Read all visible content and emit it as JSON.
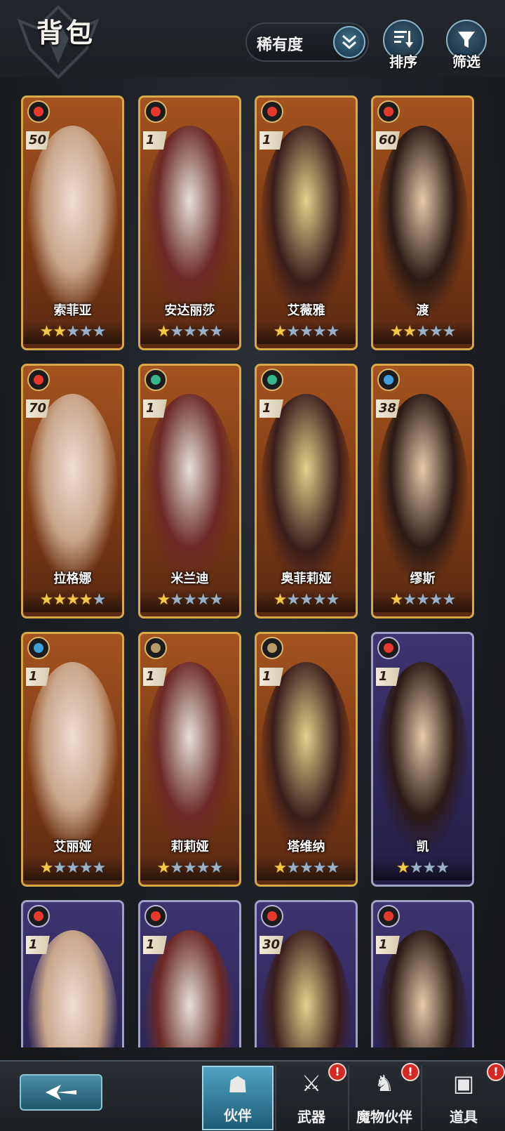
{
  "header": {
    "title": "背包",
    "sort_dropdown": {
      "selected": "稀有度"
    },
    "sort_button_label": "排序",
    "filter_button_label": "筛选"
  },
  "cards": [
    {
      "name": "索菲亚",
      "level": "50",
      "element": "fire",
      "rarity": "gold",
      "stars": 2,
      "max_stars": 5
    },
    {
      "name": "安达丽莎",
      "level": "1",
      "element": "fire",
      "rarity": "gold",
      "stars": 1,
      "max_stars": 5
    },
    {
      "name": "艾薇雅",
      "level": "1",
      "element": "fire",
      "rarity": "gold",
      "stars": 1,
      "max_stars": 5
    },
    {
      "name": "渡",
      "level": "60",
      "element": "fire",
      "rarity": "gold",
      "stars": 2,
      "max_stars": 5
    },
    {
      "name": "拉格娜",
      "level": "70",
      "element": "fire",
      "rarity": "gold",
      "stars": 4,
      "max_stars": 5
    },
    {
      "name": "米兰迪",
      "level": "1",
      "element": "wind",
      "rarity": "gold",
      "stars": 1,
      "max_stars": 5
    },
    {
      "name": "奥菲莉娅",
      "level": "1",
      "element": "wind",
      "rarity": "gold",
      "stars": 1,
      "max_stars": 5
    },
    {
      "name": "缪斯",
      "level": "38",
      "element": "water",
      "rarity": "gold",
      "stars": 1,
      "max_stars": 5
    },
    {
      "name": "艾丽娅",
      "level": "1",
      "element": "water",
      "rarity": "gold",
      "stars": 1,
      "max_stars": 5
    },
    {
      "name": "莉莉娅",
      "level": "1",
      "element": "earth",
      "rarity": "gold",
      "stars": 1,
      "max_stars": 5
    },
    {
      "name": "塔维纳",
      "level": "1",
      "element": "earth",
      "rarity": "gold",
      "stars": 1,
      "max_stars": 5
    },
    {
      "name": "凯",
      "level": "1",
      "element": "fire",
      "rarity": "purple",
      "stars": 1,
      "max_stars": 4
    },
    {
      "name": "",
      "level": "1",
      "element": "fire",
      "rarity": "purple",
      "stars": 0,
      "max_stars": 0
    },
    {
      "name": "",
      "level": "1",
      "element": "fire",
      "rarity": "purple",
      "stars": 0,
      "max_stars": 0
    },
    {
      "name": "",
      "level": "30",
      "element": "fire",
      "rarity": "purple",
      "stars": 0,
      "max_stars": 0
    },
    {
      "name": "",
      "level": "1",
      "element": "fire",
      "rarity": "purple",
      "stars": 0,
      "max_stars": 0
    }
  ],
  "colors": {
    "fire": "#e5392e",
    "wind": "#35b58a",
    "water": "#3f9fd6",
    "earth": "#b59a6a",
    "star_on": "#f3c94a",
    "star_off": "#9ab0c6"
  },
  "bottom_nav": {
    "back_icon": "arrow-left-icon",
    "tabs": [
      {
        "label": "伙伴",
        "icon": "companion-icon",
        "active": true,
        "badge": ""
      },
      {
        "label": "武器",
        "icon": "crossed-swords-icon",
        "active": false,
        "badge": "!"
      },
      {
        "label": "魔物伙伴",
        "icon": "dragon-icon",
        "active": false,
        "badge": "!"
      },
      {
        "label": "道具",
        "icon": "backpack-icon",
        "active": false,
        "badge": "!"
      }
    ]
  }
}
